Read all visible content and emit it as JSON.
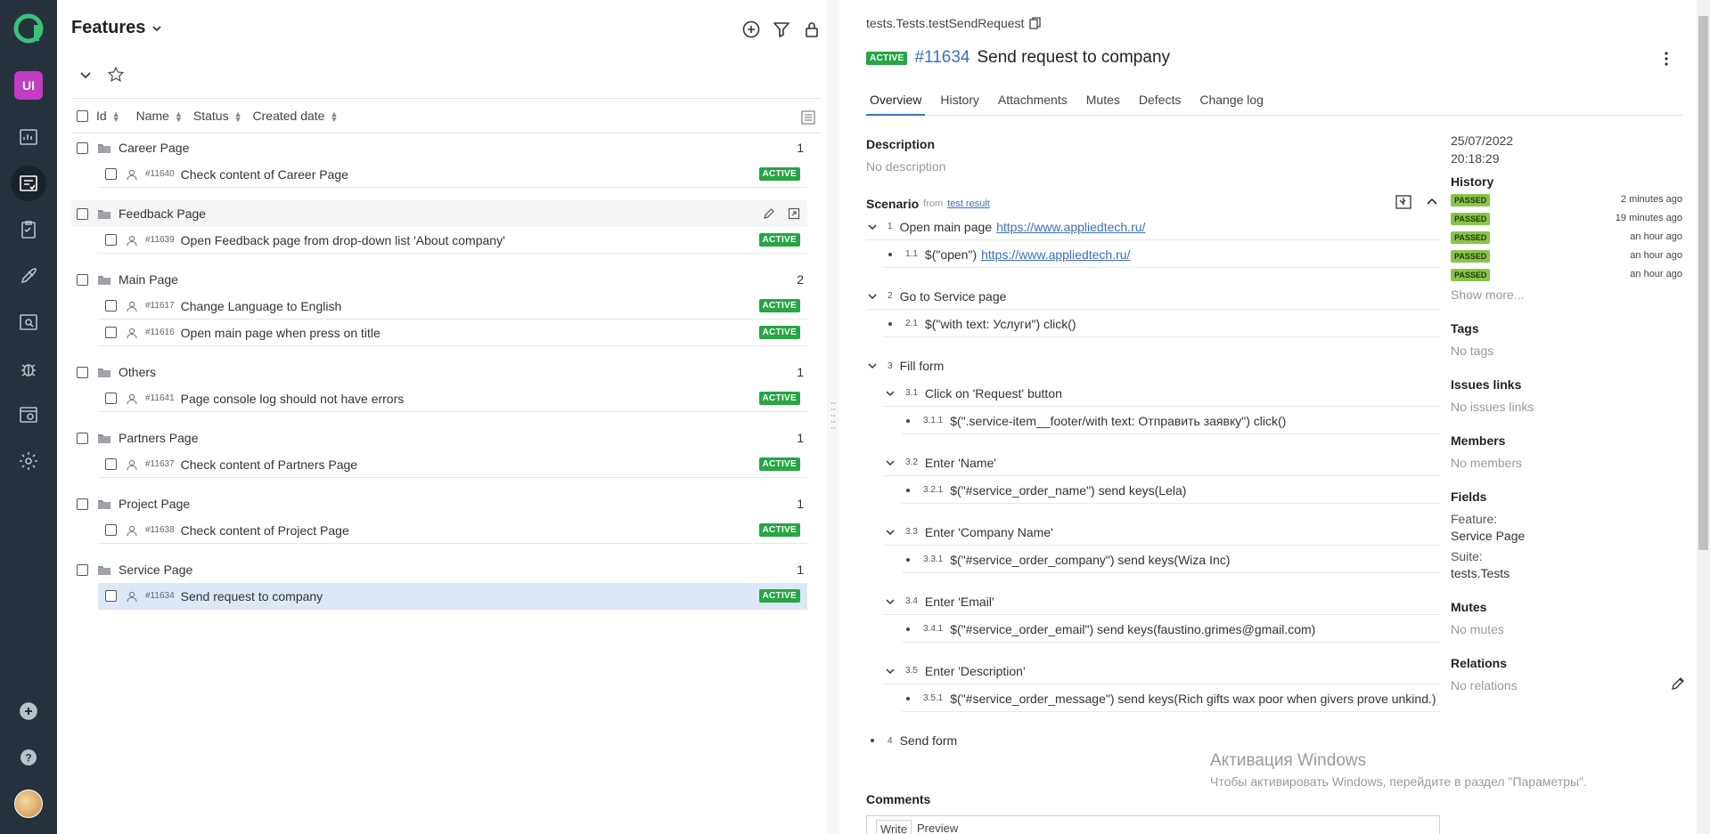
{
  "sidebar": {
    "project_initials": "UI",
    "items": [
      {
        "name": "dashboards-icon"
      },
      {
        "name": "test-cases-icon",
        "active": true
      },
      {
        "name": "test-plans-icon"
      },
      {
        "name": "launches-icon"
      },
      {
        "name": "analytics-icon"
      },
      {
        "name": "defects-icon"
      },
      {
        "name": "jobs-icon"
      },
      {
        "name": "settings-icon"
      }
    ]
  },
  "tree": {
    "title": "Features",
    "columns": {
      "id": "Id",
      "name": "Name",
      "status": "Status",
      "created": "Created date"
    },
    "groups": [
      {
        "name": "Career Page",
        "count": "1",
        "cases": [
          {
            "id": "#11640",
            "name": "Check content of Career Page",
            "status": "ACTIVE"
          }
        ]
      },
      {
        "name": "Feedback Page",
        "count": "",
        "cases": [
          {
            "id": "#11639",
            "name": "Open Feedback page from drop-down list 'About company'",
            "status": "ACTIVE"
          }
        ]
      },
      {
        "name": "Main Page",
        "count": "2",
        "cases": [
          {
            "id": "#11617",
            "name": "Change Language to English",
            "status": "ACTIVE"
          },
          {
            "id": "#11616",
            "name": "Open main page when press on title",
            "status": "ACTIVE"
          }
        ]
      },
      {
        "name": "Others",
        "count": "1",
        "cases": [
          {
            "id": "#11641",
            "name": "Page console log should not have errors",
            "status": "ACTIVE"
          }
        ]
      },
      {
        "name": "Partners Page",
        "count": "1",
        "cases": [
          {
            "id": "#11637",
            "name": "Check content of Partners Page",
            "status": "ACTIVE"
          }
        ]
      },
      {
        "name": "Project Page",
        "count": "1",
        "cases": [
          {
            "id": "#11638",
            "name": "Check content of Project Page",
            "status": "ACTIVE"
          }
        ]
      },
      {
        "name": "Service Page",
        "count": "1",
        "cases": [
          {
            "id": "#11634",
            "name": "Send request to company",
            "status": "ACTIVE"
          }
        ]
      }
    ]
  },
  "detail": {
    "full_name": "tests.Tests.testSendRequest",
    "status": "ACTIVE",
    "id": "#11634",
    "name": "Send request to company",
    "tabs": [
      "Overview",
      "History",
      "Attachments",
      "Mutes",
      "Defects",
      "Change log"
    ],
    "description_label": "Description",
    "description": "No description",
    "scenario_label": "Scenario",
    "scenario_from": "from",
    "scenario_source": "test result",
    "steps": [
      {
        "num": "1",
        "text": "Open main page",
        "link": "https://www.appliedtech.ru/"
      },
      {
        "num": "1.1",
        "text": "$(\"open\")",
        "link": "https://www.appliedtech.ru/"
      },
      {
        "num": "2",
        "text": "Go to Service page"
      },
      {
        "num": "2.1",
        "text": "$(\"with text: Услуги\") click()"
      },
      {
        "num": "3",
        "text": "Fill form"
      },
      {
        "num": "3.1",
        "text": "Click on 'Request' button"
      },
      {
        "num": "3.1.1",
        "text": "$(\".service-item__footer/with text: Отправить заявку\") click()"
      },
      {
        "num": "3.2",
        "text": "Enter 'Name'"
      },
      {
        "num": "3.2.1",
        "text": "$(\"#service_order_name\") send keys(Lela)"
      },
      {
        "num": "3.3",
        "text": "Enter 'Company Name'"
      },
      {
        "num": "3.3.1",
        "text": "$(\"#service_order_company\") send keys(Wiza Inc)"
      },
      {
        "num": "3.4",
        "text": "Enter 'Email'"
      },
      {
        "num": "3.4.1",
        "text": "$(\"#service_order_email\") send keys(faustino.grimes@gmail.com)"
      },
      {
        "num": "3.5",
        "text": "Enter 'Description'"
      },
      {
        "num": "3.5.1",
        "text": "$(\"#service_order_message\") send keys(Rich gifts wax poor when givers prove unkind.)"
      },
      {
        "num": "4",
        "text": "Send form"
      }
    ],
    "comments_label": "Comments",
    "editor_tabs": {
      "write": "Write",
      "preview": "Preview"
    }
  },
  "side": {
    "date": "25/07/2022",
    "time": "20:18:29",
    "history_label": "History",
    "history": [
      {
        "status": "PASSED",
        "ago": "2 minutes ago"
      },
      {
        "status": "PASSED",
        "ago": "19 minutes ago"
      },
      {
        "status": "PASSED",
        "ago": "an hour ago"
      },
      {
        "status": "PASSED",
        "ago": "an hour ago"
      },
      {
        "status": "PASSED",
        "ago": "an hour ago"
      }
    ],
    "show_more": "Show more...",
    "tags_label": "Tags",
    "tags": "No tags",
    "issues_label": "Issues links",
    "issues": "No issues links",
    "members_label": "Members",
    "members": "No members",
    "fields_label": "Fields",
    "feature_label": "Feature:",
    "feature": "Service Page",
    "suite_label": "Suite:",
    "suite": "tests.Tests",
    "mutes_label": "Mutes",
    "mutes": "No mutes",
    "relations_label": "Relations",
    "relations": "No relations"
  },
  "watermark": {
    "line1": "Активация Windows",
    "line2": "Чтобы активировать Windows, перейдите в раздел \"Параметры\"."
  },
  "colors": {
    "accent": "#3b6fc4",
    "active_badge": "#26a644",
    "passed_badge": "#8bc34a",
    "rail": "#26313e"
  }
}
